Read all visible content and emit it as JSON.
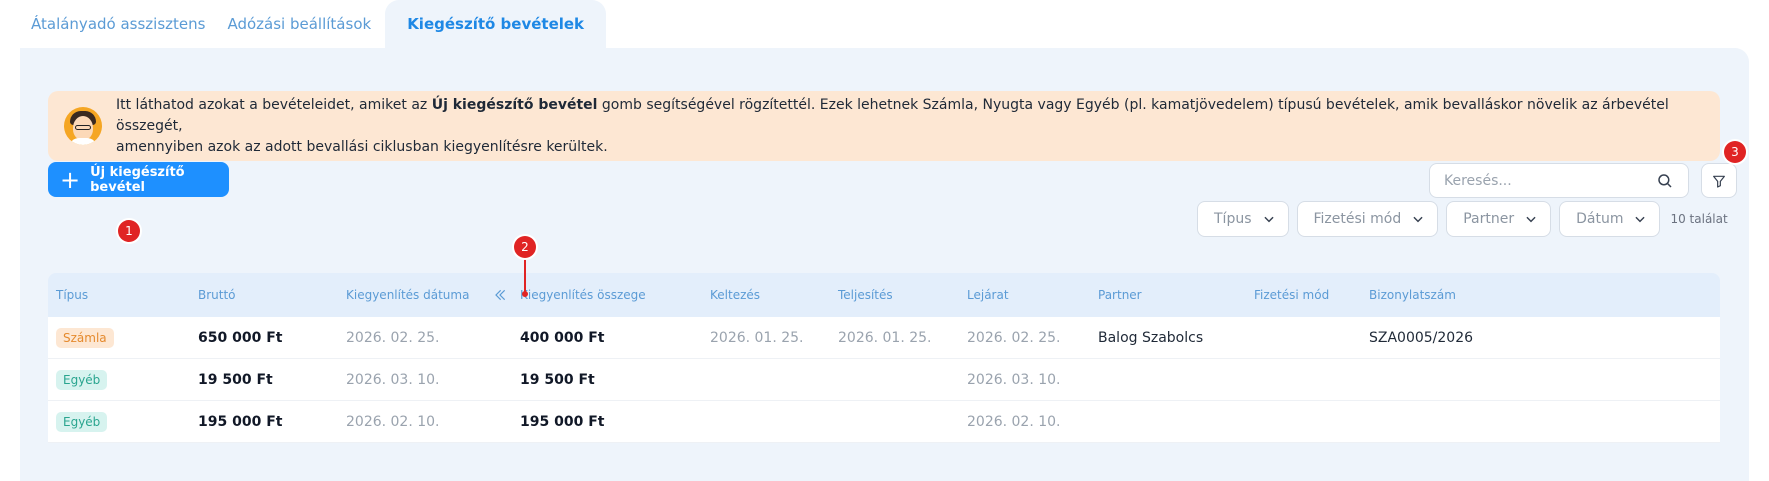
{
  "tabs": [
    {
      "label": "Átalányadó asszisztens",
      "active": false
    },
    {
      "label": "Adózási beállítások",
      "active": false
    },
    {
      "label": "Kiegészítő bevételek",
      "active": true
    }
  ],
  "banner": {
    "text_before": "Itt láthatod azokat a bevételeidet, amiket az ",
    "bold": "Új kiegészítő bevétel",
    "text_after": " gomb segítségével rögzítettél. Ezek lehetnek Számla, Nyugta vagy Egyéb (pl. kamatjövedelem) típusú bevételek, amik bevalláskor növelik az árbevétel összegét,",
    "line2": "amennyiben azok az adott bevallási ciklusban kiegyenlítésre kerültek."
  },
  "new_button_label": "Új kiegészítő bevétel",
  "search": {
    "placeholder": "Keresés..."
  },
  "filters": [
    {
      "label": "Típus"
    },
    {
      "label": "Fizetési mód"
    },
    {
      "label": "Partner"
    },
    {
      "label": "Dátum"
    }
  ],
  "results_count": "10 találat",
  "markers": [
    "1",
    "2",
    "3"
  ],
  "table": {
    "headers": [
      "Típus",
      "Bruttó",
      "Kiegyenlítés dátuma",
      "Kiegyenlítés összege",
      "Keltezés",
      "Teljesítés",
      "Lejárat",
      "Partner",
      "Fizetési mód",
      "Bizonylatszám"
    ],
    "rows": [
      {
        "type": "Számla",
        "brutto": "650 000 Ft",
        "kiegy_datum": "2026. 02. 25.",
        "kiegy_osszeg": "400 000 Ft",
        "keltezes": "2026. 01. 25.",
        "teljesites": "2026. 01. 25.",
        "lejarat": "2026. 02. 25.",
        "partner": "Balog Szabolcs",
        "fizetesi_mod": "",
        "bizonylatszam": "SZA0005/2026"
      },
      {
        "type": "Egyéb",
        "brutto": "19 500 Ft",
        "kiegy_datum": "2026. 03. 10.",
        "kiegy_osszeg": "19 500 Ft",
        "keltezes": "",
        "teljesites": "",
        "lejarat": "2026. 03. 10.",
        "partner": "",
        "fizetesi_mod": "",
        "bizonylatszam": ""
      },
      {
        "type": "Egyéb",
        "brutto": "195 000 Ft",
        "kiegy_datum": "2026. 02. 10.",
        "kiegy_osszeg": "195 000 Ft",
        "keltezes": "",
        "teljesites": "",
        "lejarat": "2026. 02. 10.",
        "partner": "",
        "fizetesi_mod": "",
        "bizonylatszam": ""
      }
    ]
  },
  "colors": {
    "accent": "#1e90ff",
    "marker": "#e02424",
    "banner_bg": "#fde7d3",
    "panel_bg": "#eef4fb"
  }
}
